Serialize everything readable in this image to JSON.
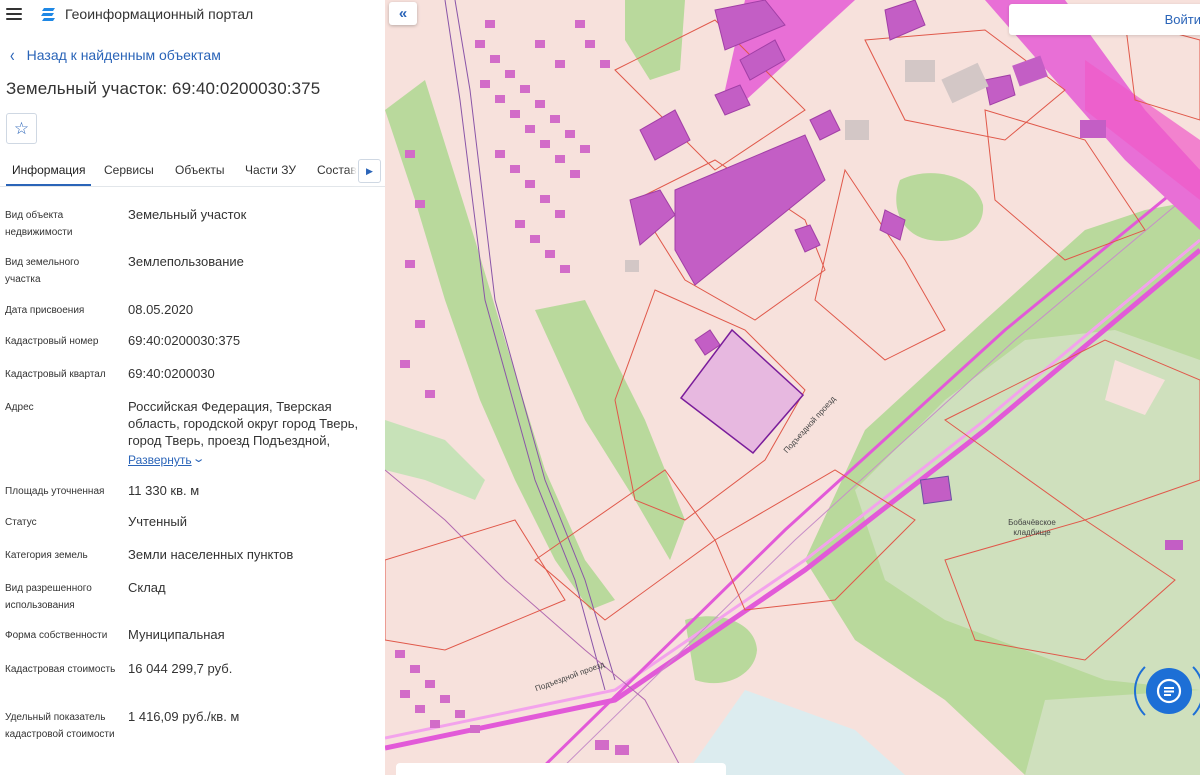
{
  "app": {
    "title": "Геоинформационный портал"
  },
  "nav": {
    "back_label": "Назад к найденным объектам"
  },
  "object": {
    "title": "Земельный участок: 69:40:0200030:375"
  },
  "tabs": [
    {
      "label": "Информация",
      "active": true
    },
    {
      "label": "Сервисы",
      "active": false
    },
    {
      "label": "Объекты",
      "active": false
    },
    {
      "label": "Части ЗУ",
      "active": false
    },
    {
      "label": "Состав",
      "active": false
    }
  ],
  "fields": {
    "object_type": {
      "label": "Вид объекта недвижимости",
      "value": "Земельный участок"
    },
    "land_type": {
      "label": "Вид земельного участка",
      "value": "Землепользование"
    },
    "date": {
      "label": "Дата присвоения",
      "value": "08.05.2020"
    },
    "cad_number": {
      "label": "Кадастровый номер",
      "value": "69:40:0200030:375"
    },
    "cad_block": {
      "label": "Кадастровый квартал",
      "value": "69:40:0200030"
    },
    "address": {
      "label": "Адрес",
      "value": "Российская Федерация, Тверская область, городской округ город Тверь, город Тверь, проезд Подъездной,",
      "expand_label": "Развернуть"
    },
    "area": {
      "label": "Площадь уточненная",
      "value": "11 330 кв. м"
    },
    "status": {
      "label": "Статус",
      "value": "Учтенный"
    },
    "category": {
      "label": "Категория земель",
      "value": "Земли населенных пунктов"
    },
    "permitted_use": {
      "label": "Вид разрешенного использования",
      "value": "Склад"
    },
    "ownership": {
      "label": "Форма собственности",
      "value": "Муниципальная"
    },
    "cad_value": {
      "label": "Кадастровая стоимость",
      "value": "16 044 299,7 руб."
    },
    "specific_value": {
      "label": "Удельный показатель кадастровой стоимости",
      "value": "1 416,09 руб./кв. м"
    }
  },
  "map": {
    "login_label": "Войти",
    "labels": {
      "cemetery": "Бобачёвское кладбище",
      "road1": "Подъездной проезд",
      "road2": "Подъездной проезд"
    }
  },
  "colors": {
    "accent": "#2a64b8",
    "map_background": "#f7e1dc",
    "building": "#c25bc2",
    "highlighted_parcel": "#e7b8e0",
    "highlighted_border": "#7a1d9b",
    "green_area": "#b6d99a",
    "parcel_border": "#e0584a"
  },
  "icons": [
    "menu-icon",
    "portal-logo-icon",
    "chevron-left-icon",
    "star-icon",
    "chevron-right-icon",
    "chevron-down-icon",
    "double-chevron-left-icon",
    "chat-icon"
  ]
}
